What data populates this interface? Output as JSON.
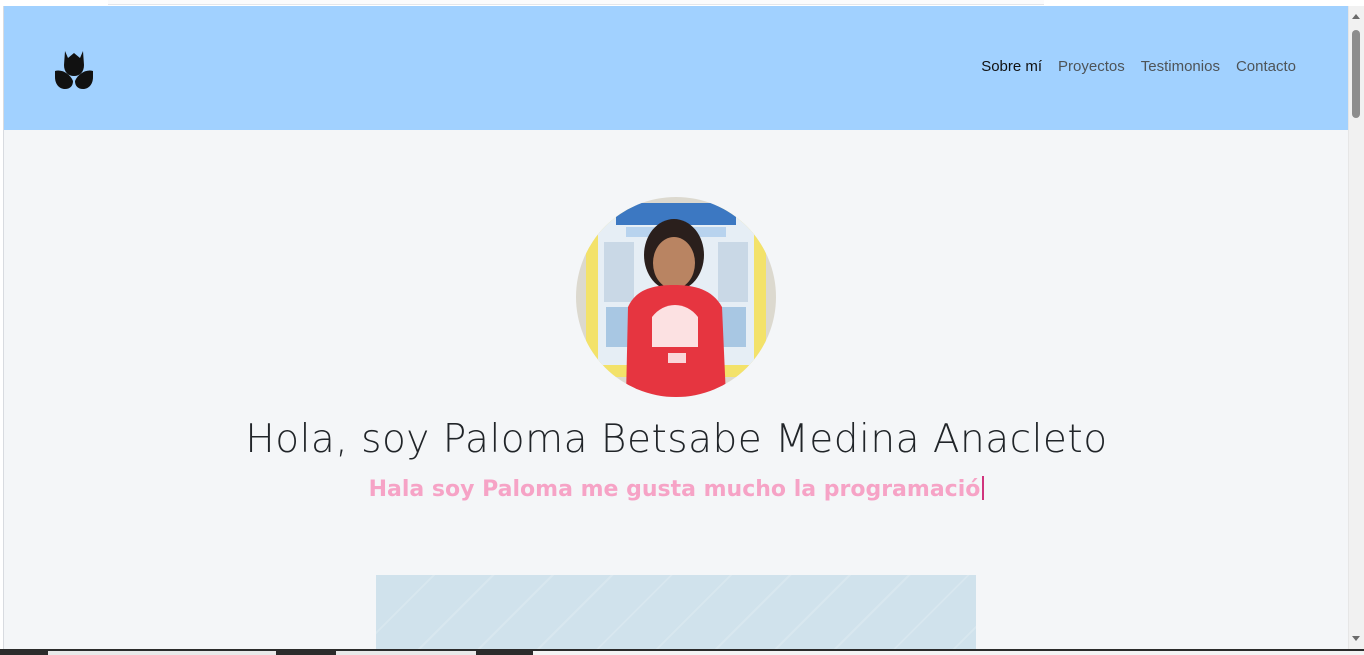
{
  "logo": {
    "icon": "tulip-icon"
  },
  "nav": {
    "items": [
      {
        "label": "Sobre mí",
        "active": true
      },
      {
        "label": "Proyectos",
        "active": false
      },
      {
        "label": "Testimonios",
        "active": false
      },
      {
        "label": "Contacto",
        "active": false
      }
    ]
  },
  "hero": {
    "title": "Hola, soy Paloma Betsabe Medina Anacleto",
    "subtitle": "Hala soy Paloma me gusta mucho la programació"
  },
  "colors": {
    "navbar": "#a1d1ff",
    "page_background": "#f4f6f8",
    "subtitle": "#f6a3c6",
    "caret": "#d0347d",
    "section_box": "#d0e2ec"
  }
}
